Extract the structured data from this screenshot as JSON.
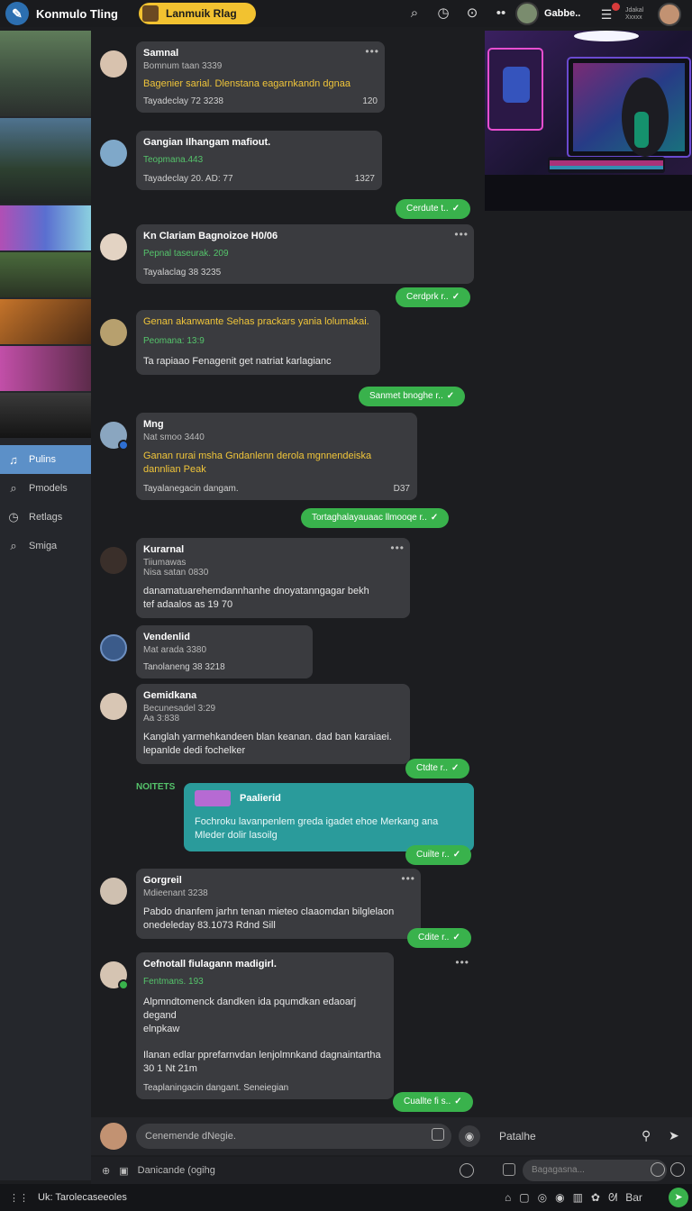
{
  "app": {
    "title": "Konmulo Tling",
    "room": "Lanmuik Rlag"
  },
  "topbar": {
    "user_name": "Gabbe..",
    "mini_text": "Jdakal Xxxxx"
  },
  "nav": [
    {
      "label": "Pulins",
      "icon": "music-icon"
    },
    {
      "label": "Pmodels",
      "icon": "search-icon"
    },
    {
      "label": "Retlags",
      "icon": "clock-icon"
    },
    {
      "label": "Smiga",
      "icon": "search-icon"
    }
  ],
  "messages": [
    {
      "name": "Samnal",
      "sub": "Bomnum taan 3339",
      "line": "Bagenier sarial. Dlenstana eagarnkandn dgnaa",
      "meta": "Tayadeclay 72 3238",
      "count": "120"
    },
    {
      "name": "Gangian Ilhangam mafiout.",
      "green": "Teopmana.443",
      "meta": "Tayadeclay 20. AD: 77",
      "count": "1327"
    },
    {
      "name": "Kn Clariam Bagnoizoe H0/06",
      "green": "Pepnal taseurak. 209",
      "meta": "Tayalaclag 38 3235"
    },
    {
      "yellow": "Genan akanwante Sehas prackars yania lolumakai.",
      "green": "Peomana: 13:9",
      "txt": "Ta rapiaao   Fenagenit get natriat karlagianc"
    },
    {
      "name": "Mng",
      "sub": "Nat smoo 3440",
      "yellow": "Ganan rurai msha Gndanlenn derola mgnnendeiska dannlian Peak",
      "meta": "Tayalanegacin dangam.",
      "count": "D37"
    },
    {
      "name": "Kurarnal",
      "sub": "Tiiumawas\nNisa satan 0830",
      "txt": "danamatuarehemdannhanhe dnoyatanngagar bekh\ntef adaalos   as 19 70"
    },
    {
      "name": "Vendenlid",
      "sub": "Mat arada 3380",
      "meta": "Tanolaneng 38 3218"
    },
    {
      "name": "Gemidkana",
      "sub": "Becunesadel 3:29\nAa  3:838",
      "txt": "Kanglah yarmehkandeen blan keanan. dad ban karaiaei.\nlepanlde dedi fochelker"
    },
    {
      "name": "Gorgreil",
      "sub": "Mdieenant 3238",
      "txt": "Pabdo dnanfem jarhn tenan mieteo claaomdan bilglelaon\nonedeleday 83.1073   Rdnd Sill"
    },
    {
      "name": "Cefnotall fiulagann madigirl.",
      "green": "Fentmans. 193",
      "txt": "Alpmndtomenck dandken ida pqumdkan edaoarj degand\nelnpkaw",
      "txt2": "Ilanan edlar pprefarnvdan lenjolmnkand dagnaintartha\n30 1 Nt 21m",
      "meta": "Teaplaningacin dangant.   Seneiegian"
    }
  ],
  "sent": [
    {
      "label": "Cerdute t.."
    },
    {
      "label": "Cerdprk r.."
    },
    {
      "label": "Sanmet bnoghe r.."
    },
    {
      "label": "Tortaghalayauaac llmooqe r.."
    },
    {
      "label": "Ctdte r.."
    },
    {
      "label": "Cuilte r.."
    },
    {
      "label": "Cdite r.."
    },
    {
      "label": "Cuallte fi s.."
    }
  ],
  "notif": {
    "label": "NOITETS",
    "title": "Paalierid",
    "text": "Fochroku lavanpenlem greda igadet ehoe Merkang ana Mleder dolir lasoilg"
  },
  "input": {
    "placeholder": "Cenemende dNegie.",
    "toolbar_text": "Danicande (ogihg"
  },
  "right_panel": {
    "label": "Patalhe",
    "field": "Bagagasna..."
  },
  "statusbar": {
    "text": "Uk: Tarolecaseeoles",
    "right_text": "Bar"
  }
}
